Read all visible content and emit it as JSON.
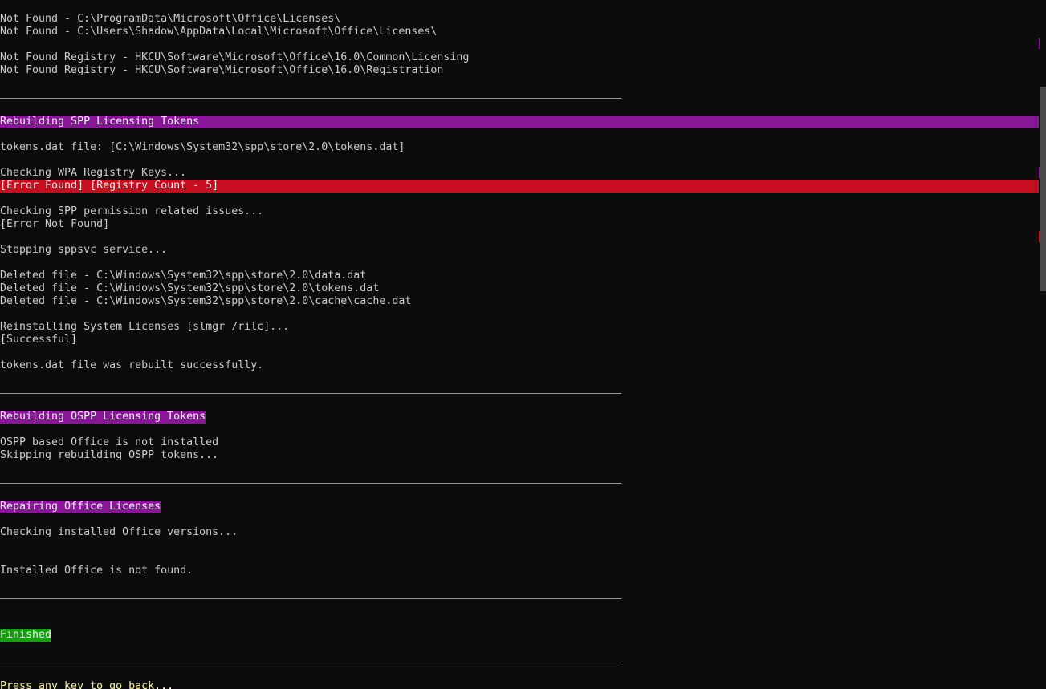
{
  "console": {
    "not_found_1": "Not Found - C:\\ProgramData\\Microsoft\\Office\\Licenses\\",
    "not_found_2": "Not Found - C:\\Users\\Shadow\\AppData\\Local\\Microsoft\\Office\\Licenses\\",
    "not_found_reg_1": "Not Found Registry - HKCU\\Software\\Microsoft\\Office\\16.0\\Common\\Licensing",
    "not_found_reg_2": "Not Found Registry - HKCU\\Software\\Microsoft\\Office\\16.0\\Registration",
    "section_spp": "Rebuilding SPP Licensing Tokens",
    "tokens_file": "tokens.dat file: [C:\\Windows\\System32\\spp\\store\\2.0\\tokens.dat]",
    "checking_wpa": "Checking WPA Registry Keys...",
    "wpa_error": "[Error Found] [Registry Count - 5]",
    "checking_spp_perm": "Checking SPP permission related issues...",
    "spp_perm_result": "[Error Not Found]",
    "stopping_service": "Stopping sppsvc service...",
    "deleted_1": "Deleted file - C:\\Windows\\System32\\spp\\store\\2.0\\data.dat",
    "deleted_2": "Deleted file - C:\\Windows\\System32\\spp\\store\\2.0\\tokens.dat",
    "deleted_3": "Deleted file - C:\\Windows\\System32\\spp\\store\\2.0\\cache\\cache.dat",
    "reinstalling": "Reinstalling System Licenses [slmgr /rilc]...",
    "reinstall_result": "[Successful]",
    "tokens_rebuilt": "tokens.dat file was rebuilt successfully.",
    "section_ospp": "Rebuilding OSPP Licensing Tokens",
    "ospp_not_installed": "OSPP based Office is not installed",
    "ospp_skipping": "Skipping rebuilding OSPP tokens...",
    "section_repair": "Repairing Office Licenses",
    "checking_office": "Checking installed Office versions...",
    "office_not_found": "Installed Office is not found.",
    "finished": "Finished",
    "press_key": "Press any key to go back..."
  },
  "colors": {
    "background": "#0c0c0c",
    "text": "#cccccc",
    "magenta_highlight": "#881798",
    "red_highlight": "#c50f1f",
    "green_highlight": "#13a10e",
    "prompt_yellow": "#f9f1a5"
  }
}
